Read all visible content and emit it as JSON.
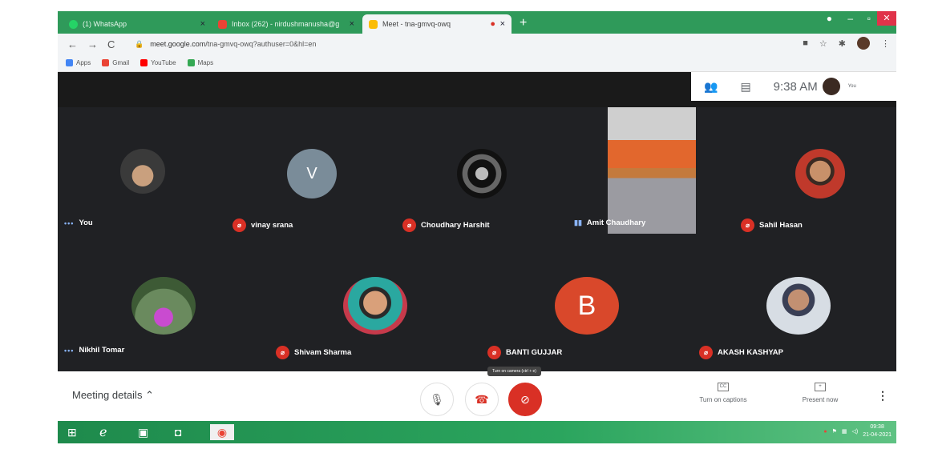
{
  "browser": {
    "tabs": [
      {
        "title": "(1) WhatsApp",
        "color": "#25d366"
      },
      {
        "title": "Inbox (262) - nirdushmanusha@g",
        "color": "#ea4335"
      },
      {
        "title": "Meet - tna-gmvq-owq",
        "color": "#fbbc04"
      }
    ],
    "url_host": "meet.google.com",
    "url_path": "/tna-gmvq-owq?authuser=0&hl=en",
    "bookmarks": [
      {
        "label": "Apps",
        "color": "#4285f4"
      },
      {
        "label": "Gmail",
        "color": "#ea4335"
      },
      {
        "label": "YouTube",
        "color": "#ff0000"
      },
      {
        "label": "Maps",
        "color": "#34a853"
      }
    ]
  },
  "meet": {
    "clock": "9:38 AM",
    "you_label": "You",
    "participants": [
      {
        "name": "You",
        "indicator": "dots",
        "avatar": "photo-dark"
      },
      {
        "name": "vinay srana",
        "indicator": "muted",
        "avatar": "initial",
        "initial": "V",
        "avatar_color": "#7a8c99"
      },
      {
        "name": "Choudhary Harshit",
        "indicator": "muted",
        "avatar": "photo-dark"
      },
      {
        "name": "Amit Chaudhary",
        "indicator": "speaking",
        "avatar": "video"
      },
      {
        "name": "Sahil Hasan",
        "indicator": "muted",
        "avatar": "photo-red"
      },
      {
        "name": "Nikhil Tomar",
        "indicator": "dots",
        "avatar": "photo-flower"
      },
      {
        "name": "Shivam Sharma",
        "indicator": "muted",
        "avatar": "photo-teal"
      },
      {
        "name": "BANTI GUJJAR",
        "indicator": "muted",
        "avatar": "initial",
        "initial": "B",
        "avatar_color": "#d9482b"
      },
      {
        "name": "AKASH KASHYAP",
        "indicator": "muted",
        "avatar": "photo-light"
      }
    ],
    "bottom": {
      "details": "Meeting details",
      "tooltip": "Turn on camera (ctrl + e)",
      "captions": "Turn on captions",
      "present": "Present now"
    }
  },
  "taskbar": {
    "time": "09:38",
    "date": "21-04-2021"
  },
  "colors": {
    "accent_red": "#d93025",
    "meet_bg": "#202124",
    "taskbar": "#2ba55e"
  }
}
